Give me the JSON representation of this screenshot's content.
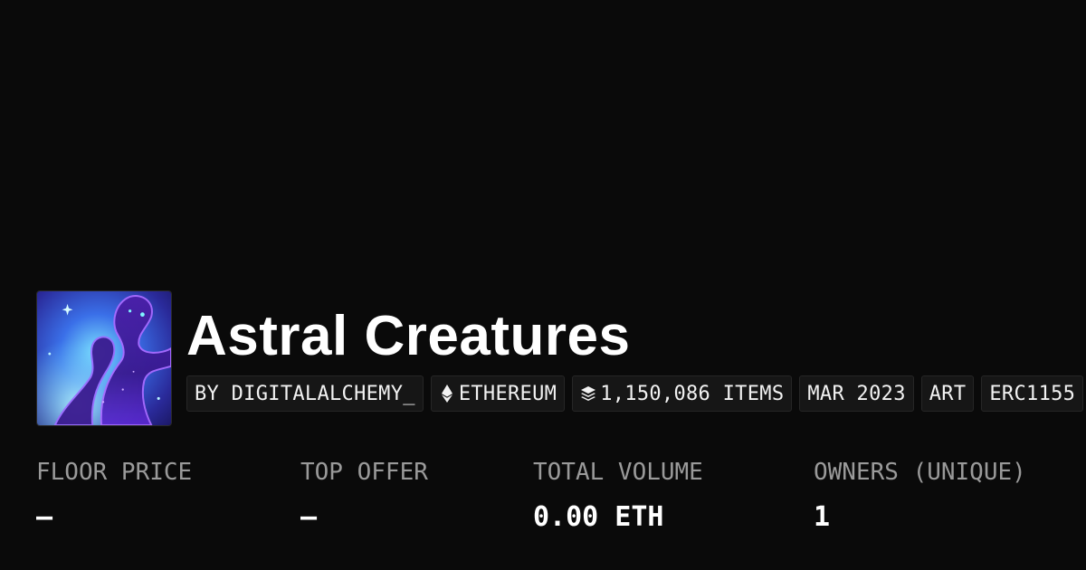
{
  "collection": {
    "name": "Astral Creatures",
    "image_alt": "Astral Creatures collection image"
  },
  "badges": [
    {
      "label": "BY DIGITALALCHEMY_",
      "icon": ""
    },
    {
      "label": "ETHEREUM",
      "icon": "ethereum-icon"
    },
    {
      "label": "1,150,086 ITEMS",
      "icon": "layers-icon"
    },
    {
      "label": "MAR 2023",
      "icon": ""
    },
    {
      "label": "ART",
      "icon": ""
    },
    {
      "label": "ERC1155",
      "icon": ""
    }
  ],
  "stats": [
    {
      "label": "FLOOR PRICE",
      "value": "–"
    },
    {
      "label": "TOP OFFER",
      "value": "–"
    },
    {
      "label": "TOTAL VOLUME",
      "value": "0.00 ETH"
    },
    {
      "label": "OWNERS (UNIQUE)",
      "value": "1"
    }
  ],
  "colors": {
    "background": "#0a0a0a",
    "badge_background": "#161616",
    "label_gray": "#9a9a9a",
    "text": "#ffffff"
  }
}
